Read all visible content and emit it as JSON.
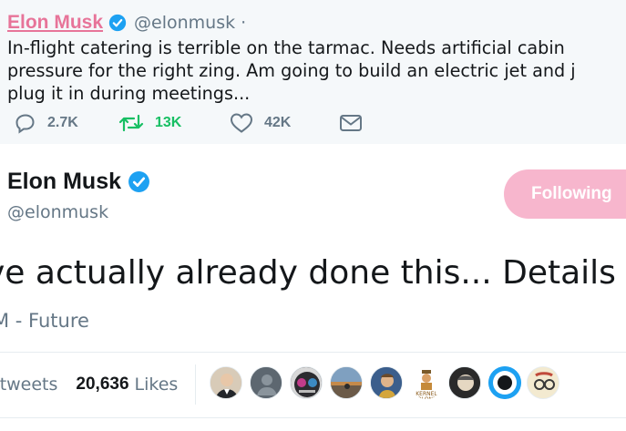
{
  "quoted_tweet": {
    "name": "Elon Musk",
    "handle": "@elonmusk",
    "separator": "·",
    "text_lines": [
      "In-flight catering is terrible on the tarmac. Needs artificial cabin pressure for the right zing. Am going to build an electric jet and just",
      "pressure for the right zing. Am going to build an electric jet and j",
      "plug it in during meetings..."
    ],
    "actions": {
      "reply_count": "2.7K",
      "retweet_count": "13K",
      "like_count": "42K"
    }
  },
  "main_tweet": {
    "name": "Elon Musk",
    "handle": "@elonmusk",
    "follow_label": "Following",
    "text": "ve actually already done this... Details s",
    "meta": "M - Future",
    "stats": {
      "retweets_label": "etweets",
      "likes_value": "20,636",
      "likes_label": "Likes"
    }
  },
  "icons": {
    "verified": "verified-badge-icon",
    "reply": "reply-icon",
    "retweet": "retweet-icon",
    "like": "heart-icon",
    "message": "envelope-icon"
  },
  "colors": {
    "twitter_blue": "#1da1f2",
    "retweet_green": "#17bf63",
    "follow_pink": "#f7b6cd",
    "name_pink": "#e0245e",
    "secondary_gray": "#657786"
  }
}
